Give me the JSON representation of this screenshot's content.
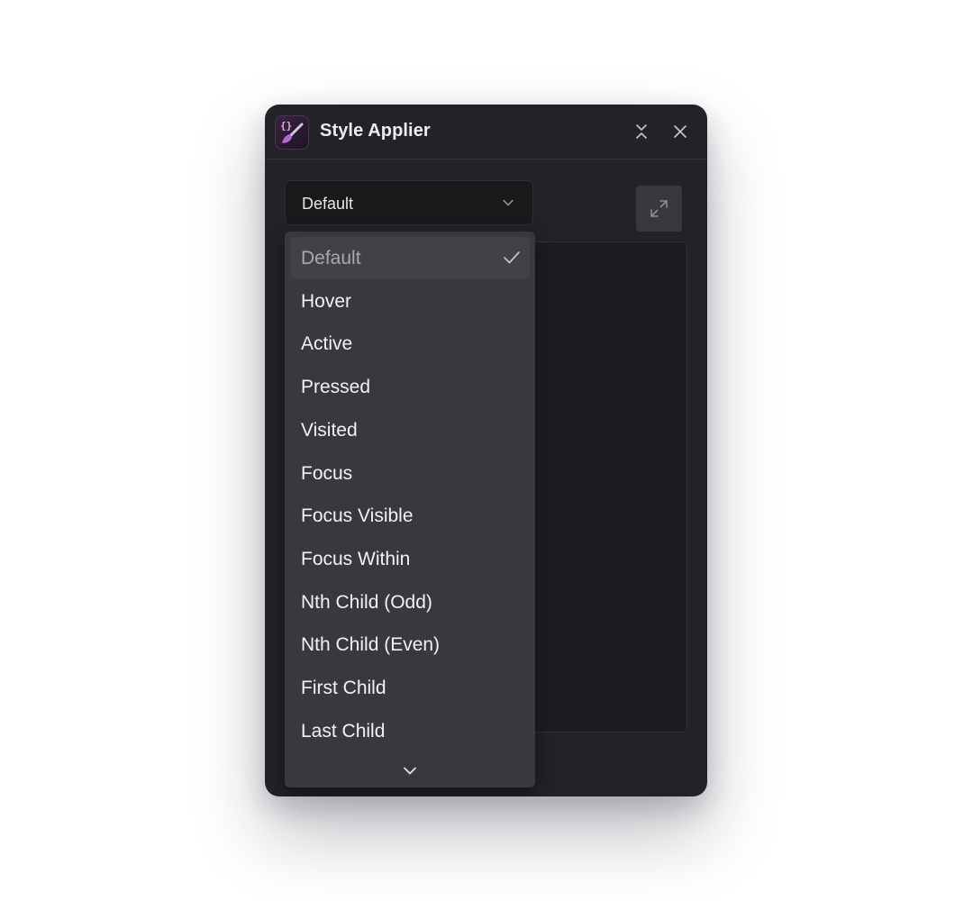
{
  "window": {
    "title": "Style Applier",
    "app_icon": "style-applier-logo-icon",
    "collapse_icon": "collapse-icon",
    "close_icon": "close-icon"
  },
  "state_select": {
    "value": "Default",
    "icon": "chevron-down-icon"
  },
  "expand_button": {
    "icon": "expand-icon"
  },
  "dropdown": {
    "items": [
      {
        "label": "Default",
        "selected": true
      },
      {
        "label": "Hover"
      },
      {
        "label": "Active"
      },
      {
        "label": "Pressed"
      },
      {
        "label": "Visited"
      },
      {
        "label": "Focus"
      },
      {
        "label": "Focus Visible"
      },
      {
        "label": "Focus Within"
      },
      {
        "label": "Nth Child (Odd)"
      },
      {
        "label": "Nth Child (Even)"
      },
      {
        "label": "First Child"
      },
      {
        "label": "Last Child"
      }
    ],
    "check_icon": "check-icon",
    "more_icon": "chevron-down-icon"
  },
  "colors": {
    "panel_bg": "#232226",
    "dropdown_bg": "#39383d",
    "accent_purple": "#b06ad6",
    "text": "#f2f2f4"
  }
}
